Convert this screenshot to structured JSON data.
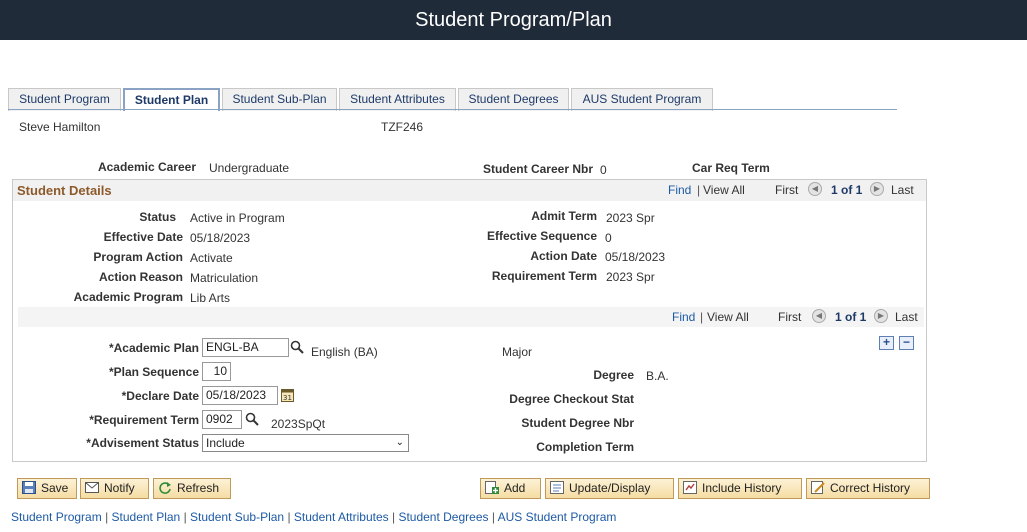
{
  "header": {
    "title": "Student Program/Plan"
  },
  "tabs": [
    {
      "label": "Student Program"
    },
    {
      "label": "Student Plan"
    },
    {
      "label": "Student Sub-Plan"
    },
    {
      "label": "Student Attributes"
    },
    {
      "label": "Student Degrees"
    },
    {
      "label": "AUS Student Program"
    }
  ],
  "student": {
    "name": "Steve Hamilton",
    "id": "TZF246"
  },
  "career": {
    "academic_career_label": "Academic Career",
    "academic_career_value": "Undergraduate",
    "career_nbr_label": "Student Career Nbr",
    "career_nbr_value": "0",
    "car_req_term_label": "Car Req Term"
  },
  "details": {
    "section_title": "Student Details",
    "find": "Find",
    "view_all": "View All",
    "first": "First",
    "count": "1 of 1",
    "last": "Last",
    "status_label": "Status",
    "status_value": "Active in Program",
    "effective_date_label": "Effective Date",
    "effective_date_value": "05/18/2023",
    "program_action_label": "Program Action",
    "program_action_value": "Activate",
    "action_reason_label": "Action Reason",
    "action_reason_value": "Matriculation",
    "academic_program_label": "Academic Program",
    "academic_program_value": "Lib Arts",
    "admit_term_label": "Admit Term",
    "admit_term_value": "2023 Spr",
    "effective_sequence_label": "Effective Sequence",
    "effective_sequence_value": "0",
    "action_date_label": "Action Date",
    "action_date_value": "05/18/2023",
    "requirement_term_label": "Requirement Term",
    "requirement_term_value": "2023 Spr"
  },
  "plan": {
    "find": "Find",
    "view_all": "View All",
    "first": "First",
    "count": "1 of 1",
    "last": "Last",
    "academic_plan_label": "*Academic Plan",
    "academic_plan_value": "ENGL-BA",
    "academic_plan_desc": "English (BA)",
    "plan_type": "Major",
    "plan_sequence_label": "*Plan Sequence",
    "plan_sequence_value": "10",
    "declare_date_label": "*Declare Date",
    "declare_date_value": "05/18/2023",
    "requirement_term_label": "*Requirement Term",
    "requirement_term_value": "0902",
    "requirement_term_desc": "2023SpQt",
    "advisement_status_label": "*Advisement Status",
    "advisement_status_value": "Include",
    "degree_label": "Degree",
    "degree_value": "B.A.",
    "degree_checkout_label": "Degree Checkout Stat",
    "student_degree_nbr_label": "Student Degree Nbr",
    "completion_term_label": "Completion Term",
    "add_row": "+",
    "delete_row": "−"
  },
  "buttons": {
    "save": "Save",
    "notify": "Notify",
    "refresh": "Refresh",
    "add": "Add",
    "update_display": "Update/Display",
    "include_history": "Include History",
    "correct_history": "Correct History"
  },
  "footer_links": [
    "Student Program",
    "Student Plan",
    "Student Sub-Plan",
    "Student Attributes",
    "Student Degrees",
    "AUS Student Program"
  ],
  "colors": {
    "titlebar": "#1f2b38",
    "link": "#1d5aa6",
    "section_title": "#8d5a2b",
    "button_border": "#c09a5a"
  }
}
